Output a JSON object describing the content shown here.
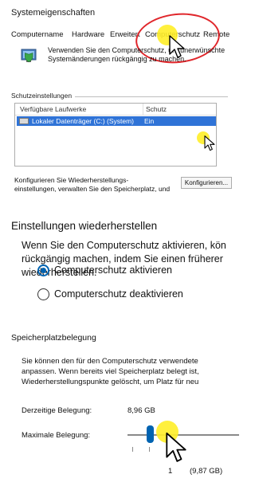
{
  "dialog": {
    "title": "Systemeigenschaften",
    "tabs": [
      "Computername",
      "Hardware",
      "Erweitert",
      "Computerschutz",
      "Remote"
    ],
    "active_tab": "Computerschutz",
    "description_line1": "Verwenden Sie den Computerschutz, um unerwünschte",
    "description_line2": "Systemänderungen rückgängig zu machen.",
    "protection_group_label": "Schutzeinstellungen",
    "table_headers": [
      "Verfügbare Laufwerke",
      "Schutz"
    ],
    "drives": [
      {
        "name": "Lokaler Datenträger (C:) (System)",
        "protection": "Ein"
      }
    ],
    "config_text_line1": "Konfigurieren Sie Wiederherstellungs-",
    "config_text_line2": "einstellungen, verwalten Sie den Speicherplatz, und",
    "config_button": "Konfigurieren..."
  },
  "restore_settings": {
    "heading": "Einstellungen wiederherstellen",
    "desc_line1": "Wenn Sie den Computerschutz aktivieren, kön",
    "desc_line2": "rückgängig machen, indem Sie einen früherer",
    "desc_line3": "wiederherstellen.",
    "option_on": "Computerschutz aktivieren",
    "option_off": "Computerschutz deaktivieren",
    "selected": "Computerschutz aktivieren"
  },
  "storage": {
    "heading": "Speicherplatzbelegung",
    "desc_line1": "Sie können den für den Computerschutz verwendete",
    "desc_line2": "anpassen. Wenn bereits viel Speicherplatz belegt ist,",
    "desc_line3": "Wiederherstellungspunkte gelöscht, um Platz für neu",
    "current_usage_label": "Derzeitige Belegung:",
    "current_usage_value": "8,96 GB",
    "max_usage_label": "Maximale Belegung:",
    "max_usage_prefix": "1",
    "max_usage_value": "(9,87 GB)",
    "slider_level": 0.18
  },
  "colors": {
    "selection": "#2f73d7",
    "radio_accent": "#0063b1",
    "annotation_circle": "#e0262b",
    "highlight": "#ffee28"
  }
}
